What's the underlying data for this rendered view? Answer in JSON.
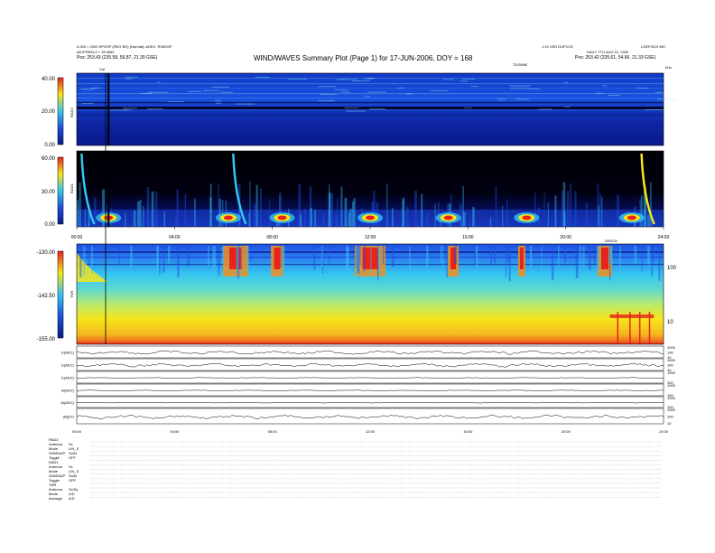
{
  "header": {
    "title": "WIND/WAVES Summary Plot (Page 1) for 17-JUN-2006, DOY = 168",
    "left_line1": "0.000 = 2000 SPOSP (REO BO) (Normal): ADEC: R/MOSP",
    "left_line2": "AEJFREEL3 + 15:0650",
    "left_line3_label": "Pos:",
    "left_line3_value": "253.43 (235.58, 56.87, 21.39 GSE)",
    "cal_label": "Cal",
    "right_line1": "1.10 VED DUFCCE",
    "right_line2_prefix": "DAILY TTU AUG 22, 2000",
    "right_line3_label": "Pos:",
    "right_line3_value": "253.42 (235.61, 54.66, 21.33 GSE)",
    "right_corner": "LOEFOCH MO",
    "tds_label": "TDS/IME",
    "khz_label": "kHz"
  },
  "chart_data": [
    {
      "type": "heatmap",
      "panel": "RAD2",
      "ylabel": "RAD2",
      "ylim": [
        0,
        40
      ],
      "y_ticks": [
        "40.00",
        "20.00",
        "0.00"
      ],
      "colors": [
        "#0b1a8c",
        "#1f4fe0",
        "#34c6f0",
        "#f7e51a",
        "#e8231a"
      ]
    },
    {
      "type": "heatmap",
      "panel": "RAD1",
      "ylabel": "RAD1",
      "ylim": [
        0,
        60
      ],
      "y_ticks": [
        "60.00",
        "30.00",
        "0.00"
      ],
      "x_ticks": [
        "00:00",
        "04:00",
        "08:00",
        "12:00",
        "16:00",
        "20:00",
        "24:00"
      ],
      "bursts_hours": [
        1.3,
        6.2,
        8.4,
        12.0,
        15.2,
        18.4,
        22.7
      ],
      "colors": [
        "#000008",
        "#0b1a8c",
        "#1f4fe0",
        "#34c6f0",
        "#f7e51a",
        "#e8231a"
      ]
    },
    {
      "type": "heatmap",
      "panel": "TNR",
      "ylabel": "TNR",
      "ylim": [
        -155,
        -130
      ],
      "y_ticks": [
        "-130.00",
        "-142.50",
        "-155.00"
      ],
      "right_ticks": [
        "100",
        "10"
      ],
      "top_right_label": "DRVCH",
      "colors": [
        "#1f4fe0",
        "#34c6f0",
        "#7de0a0",
        "#f7e51a",
        "#f09020",
        "#e8231a"
      ]
    },
    {
      "type": "line",
      "panels": [
        {
          "label": "E(ADC)",
          "right_ticks": [
            "1000",
            "100",
            "10"
          ]
        },
        {
          "label": "E(ADC)",
          "right_ticks": [
            "1000",
            "100",
            "10"
          ]
        },
        {
          "label": "E(ADC)",
          "right_ticks": [
            "1000",
            "100"
          ]
        },
        {
          "label": "B(ADC)",
          "right_ticks": [
            "1000",
            "100"
          ]
        },
        {
          "label": "Ai(ADC)",
          "right_ticks": [
            "1000",
            "100"
          ]
        },
        {
          "label": "|B|(nT)",
          "right_ticks": [
            "1000",
            "100",
            "10"
          ]
        }
      ],
      "x_ticks": [
        "00:00",
        "04:00",
        "08:00",
        "12:00",
        "16:00",
        "20:00",
        "24:00"
      ]
    }
  ],
  "footer": {
    "sections": [
      {
        "name": "RAD2",
        "lines": [
          {
            "k": "Antenna",
            "v": "Sx"
          },
          {
            "k": "Mode",
            "v": "LIN_S"
          },
          {
            "k": "SUMDA/P",
            "v": "SUM"
          },
          {
            "k": "Toggle",
            "v": "OFF"
          }
        ]
      },
      {
        "name": "RAD1",
        "lines": [
          {
            "k": "Antenna",
            "v": "Sx"
          },
          {
            "k": "Mode",
            "v": "LIN_S"
          },
          {
            "k": "SUMDA/P",
            "v": "SUM"
          },
          {
            "k": "Toggle",
            "v": "OFF"
          }
        ]
      },
      {
        "name": "TNR",
        "lines": [
          {
            "k": "Antenna",
            "v": "Sx/Sy"
          },
          {
            "k": "Mode",
            "v": "A/D"
          },
          {
            "k": "Average",
            "v": "A/D"
          }
        ]
      }
    ]
  }
}
